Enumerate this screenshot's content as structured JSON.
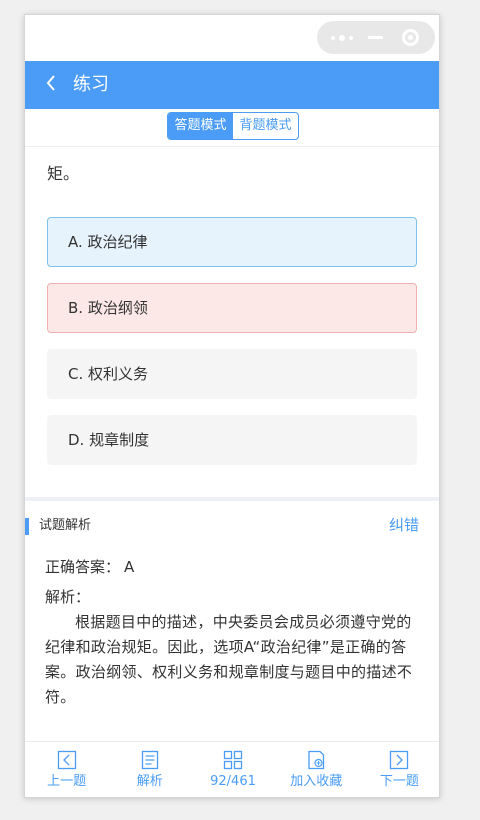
{
  "nav": {
    "title": "练习"
  },
  "mode_toggle": {
    "answer_mode": "答题模式",
    "review_mode": "背题模式"
  },
  "question": {
    "visible_text_tail": "矩。"
  },
  "options": [
    {
      "label": "A. 政治纪律",
      "state": "correct"
    },
    {
      "label": "B. 政治纲领",
      "state": "wrong"
    },
    {
      "label": "C. 权利义务",
      "state": "normal"
    },
    {
      "label": "D. 规章制度",
      "state": "normal"
    }
  ],
  "analysis": {
    "title": "试题解析",
    "report_label": "纠错",
    "correct_answer_label": "正确答案：",
    "correct_answer_value": "A",
    "explain_label": "解析：",
    "explain_text": "根据题目中的描述，中央委员会成员必须遵守党的纪律和政治规矩。因此，选项A“政治纪律”是正确的答案。政治纲领、权利义务和规章制度与题目中的描述不符。"
  },
  "tabbar": {
    "prev": "上一题",
    "analysis": "解析",
    "progress": "92/461",
    "favorite": "加入收藏",
    "next": "下一题"
  },
  "colors": {
    "primary": "#4a9cf6",
    "correct_bg": "#e6f3fc",
    "wrong_bg": "#fde8e8"
  },
  "icons": [
    "back-arrow-icon",
    "more-dots-icon",
    "minimize-icon",
    "target-close-icon",
    "prev-icon",
    "analysis-doc-icon",
    "grid-icon",
    "favorite-icon",
    "next-icon"
  ]
}
